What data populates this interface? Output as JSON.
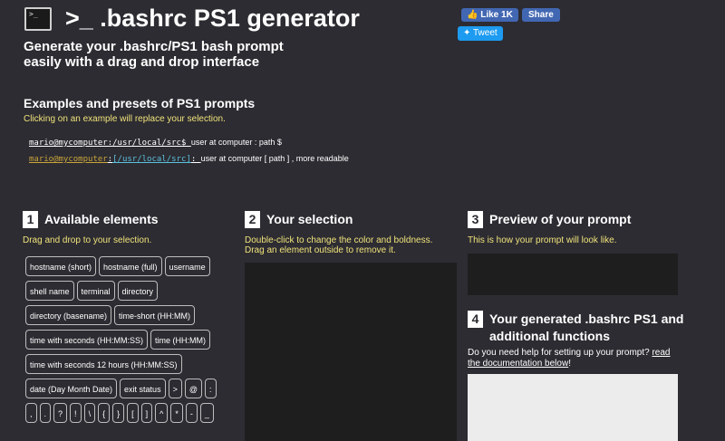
{
  "header": {
    "title": ">_ .bashrc PS1 generator",
    "tagline": "Generate your .bashrc/PS1 bash prompt easily with a drag and drop interface",
    "logo_text": ">_"
  },
  "social": {
    "like_label": "Like 1K",
    "share_label": "Share",
    "tweet_label": "Tweet"
  },
  "examples": {
    "heading": "Examples and presets of PS1 prompts",
    "hint": "Clicking on an example will replace your selection.",
    "items": [
      {
        "code_main": "mario@mycomputer:/usr/local/src$ ",
        "desc": "user at computer : path $"
      },
      {
        "code_user": "mario@mycomputer",
        "code_sep": ":",
        "code_path": "[/usr/local/src]",
        "code_end": ": ",
        "desc": "user at computer [ path ] , more readable"
      }
    ]
  },
  "available": {
    "num": "1",
    "title": "Available elements",
    "hint": "Drag and drop to your selection.",
    "items": [
      "hostname (short)",
      "hostname (full)",
      "username",
      "shell name",
      "terminal",
      "directory",
      "directory (basename)",
      "time-short (HH:MM)",
      "time with seconds (HH:MM:SS)",
      "time (HH:MM)",
      "time with seconds 12 hours (HH:MM:SS)",
      "date (Day Month Date)",
      "exit status",
      ">",
      "@",
      ":",
      ",",
      ".",
      "?",
      "!",
      "\\",
      "{",
      "}",
      "[",
      "]",
      "^",
      "*",
      "-",
      "_"
    ]
  },
  "selection": {
    "num": "2",
    "title": "Your selection",
    "hint_line1": "Double-click to change the color and boldness.",
    "hint_line2": "Drag an element outside to remove it."
  },
  "preview": {
    "num": "3",
    "title": "Preview of your prompt",
    "hint": "This is how your prompt will look like."
  },
  "generated": {
    "num": "4",
    "title": "Your generated .bashrc PS1 and additional functions",
    "help_prefix": "Do you need help for setting up your prompt? ",
    "help_link": "read the documentation below",
    "help_suffix": "!"
  },
  "colors": {
    "background": "#2d2c32",
    "hint_yellow": "#f0e37b",
    "panel_dark": "#1e1e1e",
    "code_panel": "#ececec",
    "facebook": "#4267b2",
    "twitter": "#1d9bf0"
  }
}
